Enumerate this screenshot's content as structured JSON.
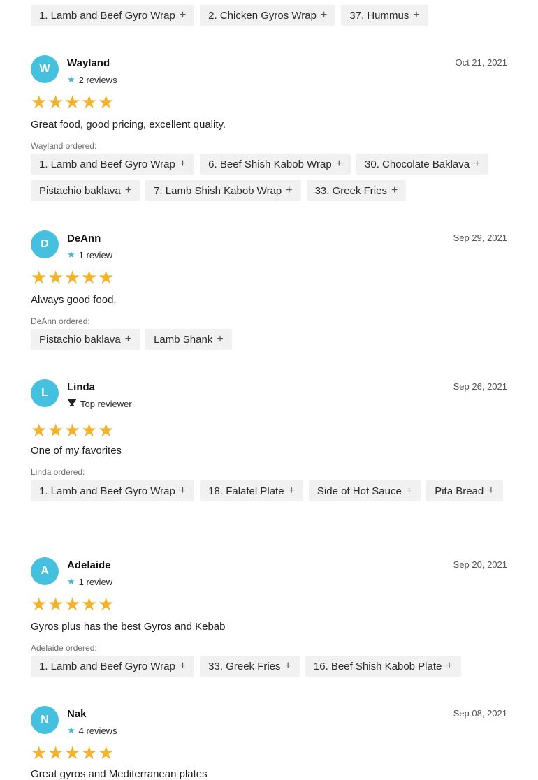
{
  "top_chips": [
    "1. Lamb and Beef Gyro Wrap",
    "2. Chicken Gyros Wrap",
    "37. Hummus"
  ],
  "plus_glyph": "+",
  "reviews": [
    {
      "initial": "W",
      "name": "Wayland",
      "badge_type": "star",
      "badge": "2 reviews",
      "date": "Oct 21, 2021",
      "rating": 5,
      "text": "Great food, good pricing, excellent quality.",
      "ordered_label": "Wayland ordered:",
      "items": [
        "1. Lamb and Beef Gyro Wrap",
        "6. Beef Shish Kabob Wrap",
        "30. Chocolate Baklava",
        "Pistachio baklava",
        "7. Lamb Shish Kabob Wrap",
        "33. Greek Fries"
      ]
    },
    {
      "initial": "D",
      "name": "DeAnn",
      "badge_type": "star",
      "badge": "1 review",
      "date": "Sep 29, 2021",
      "rating": 5,
      "text": "Always good food.",
      "ordered_label": "DeAnn ordered:",
      "items": [
        "Pistachio baklava",
        "Lamb Shank"
      ]
    },
    {
      "initial": "L",
      "name": "Linda",
      "badge_type": "trophy",
      "badge": "Top reviewer",
      "date": "Sep 26, 2021",
      "rating": 5,
      "text": "One of my favorites",
      "ordered_label": "Linda ordered:",
      "items": [
        "1. Lamb and Beef Gyro Wrap",
        "18. Falafel Plate",
        "Side of Hot Sauce",
        "Pita Bread"
      ]
    },
    {
      "initial": "A",
      "name": "Adelaide",
      "badge_type": "star",
      "badge": "1 review",
      "date": "Sep 20, 2021",
      "rating": 5,
      "text": "Gyros plus has the best Gyros and Kebab",
      "ordered_label": "Adelaide ordered:",
      "items": [
        "1. Lamb and Beef Gyro Wrap",
        "33. Greek Fries",
        "16. Beef Shish Kabob Plate"
      ]
    },
    {
      "initial": "N",
      "name": "Nak",
      "badge_type": "star",
      "badge": "4 reviews",
      "date": "Sep 08, 2021",
      "rating": 5,
      "text": "Great gyros and Mediterranean plates",
      "ordered_label": "",
      "items": []
    }
  ],
  "colors": {
    "avatar": "#45c1df",
    "star": "#f3b22c",
    "badge_star": "#3fb8d8",
    "chip_bg": "#f1f1f2"
  }
}
